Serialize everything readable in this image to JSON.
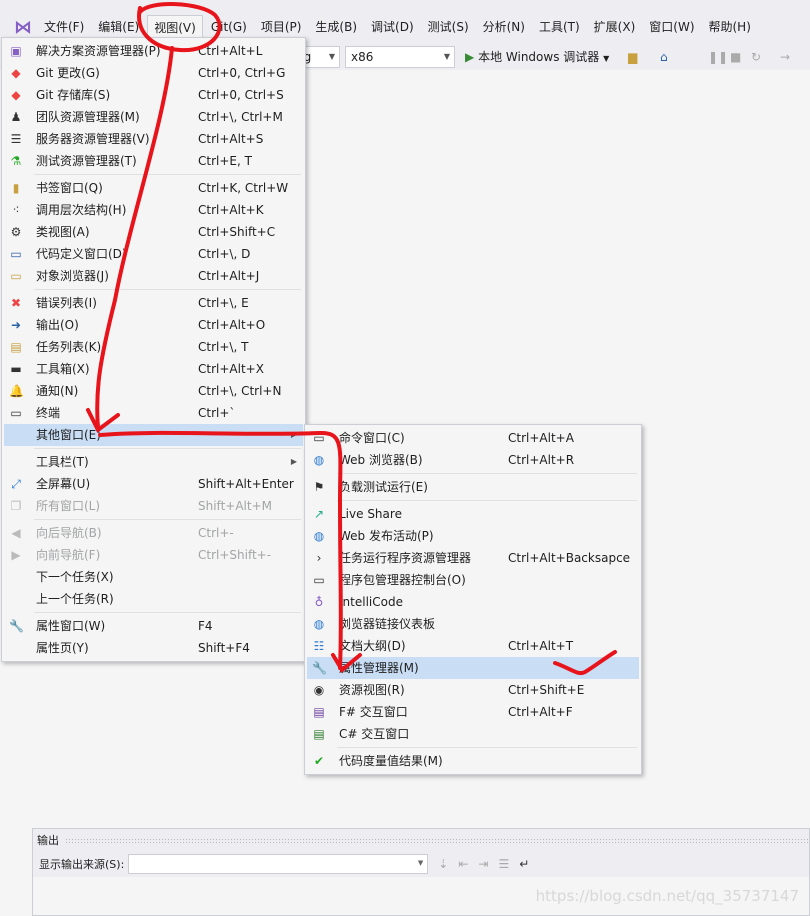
{
  "menubar": [
    "文件(F)",
    "编辑(E)",
    "视图(V)",
    "Git(G)",
    "项目(P)",
    "生成(B)",
    "调试(D)",
    "测试(S)",
    "分析(N)",
    "工具(T)",
    "扩展(X)",
    "窗口(W)",
    "帮助(H)"
  ],
  "toolbar": {
    "config": "ug",
    "platform": "x86",
    "run": "本地 Windows 调试器"
  },
  "view_menu": [
    {
      "icon": "solution-explorer-icon",
      "label": "解决方案资源管理器(P)",
      "shortcut": "Ctrl+Alt+L"
    },
    {
      "icon": "git-changes-icon",
      "label": "Git 更改(G)",
      "shortcut": "Ctrl+0, Ctrl+G"
    },
    {
      "icon": "git-repository-icon",
      "label": "Git 存储库(S)",
      "shortcut": "Ctrl+0, Ctrl+S"
    },
    {
      "icon": "team-explorer-icon",
      "label": "团队资源管理器(M)",
      "shortcut": "Ctrl+\\, Ctrl+M"
    },
    {
      "icon": "server-explorer-icon",
      "label": "服务器资源管理器(V)",
      "shortcut": "Ctrl+Alt+S"
    },
    {
      "icon": "test-explorer-icon",
      "label": "测试资源管理器(T)",
      "shortcut": "Ctrl+E, T",
      "sep": true
    },
    {
      "icon": "bookmark-icon",
      "label": "书签窗口(Q)",
      "shortcut": "Ctrl+K, Ctrl+W"
    },
    {
      "icon": "call-hierarchy-icon",
      "label": "调用层次结构(H)",
      "shortcut": "Ctrl+Alt+K"
    },
    {
      "icon": "class-view-icon",
      "label": "类视图(A)",
      "shortcut": "Ctrl+Shift+C"
    },
    {
      "icon": "code-definition-icon",
      "label": "代码定义窗口(D)",
      "shortcut": "Ctrl+\\, D"
    },
    {
      "icon": "object-browser-icon",
      "label": "对象浏览器(J)",
      "shortcut": "Ctrl+Alt+J",
      "sep": true
    },
    {
      "icon": "error-list-icon",
      "label": "错误列表(I)",
      "shortcut": "Ctrl+\\, E"
    },
    {
      "icon": "output-icon",
      "label": "输出(O)",
      "shortcut": "Ctrl+Alt+O"
    },
    {
      "icon": "task-list-icon",
      "label": "任务列表(K)",
      "shortcut": "Ctrl+\\, T"
    },
    {
      "icon": "toolbox-icon",
      "label": "工具箱(X)",
      "shortcut": "Ctrl+Alt+X"
    },
    {
      "icon": "bell-icon",
      "label": "通知(N)",
      "shortcut": "Ctrl+\\, Ctrl+N"
    },
    {
      "icon": "terminal-icon",
      "label": "终端",
      "shortcut": "Ctrl+`"
    },
    {
      "icon": "",
      "label": "其他窗口(E)",
      "shortcut": "",
      "submenu": true,
      "highlight": true,
      "sep": true
    },
    {
      "icon": "",
      "label": "工具栏(T)",
      "shortcut": "",
      "submenu": true
    },
    {
      "icon": "fullscreen-icon",
      "label": "全屏幕(U)",
      "shortcut": "Shift+Alt+Enter"
    },
    {
      "icon": "all-windows-icon",
      "label": "所有窗口(L)",
      "shortcut": "Shift+Alt+M",
      "disabled": true,
      "sep": true
    },
    {
      "icon": "navigate-back-icon",
      "label": "向后导航(B)",
      "shortcut": "Ctrl+-",
      "disabled": true
    },
    {
      "icon": "navigate-forward-icon",
      "label": "向前导航(F)",
      "shortcut": "Ctrl+Shift+-",
      "disabled": true
    },
    {
      "icon": "",
      "label": "下一个任务(X)",
      "shortcut": ""
    },
    {
      "icon": "",
      "label": "上一个任务(R)",
      "shortcut": "",
      "sep": true
    },
    {
      "icon": "wrench-icon",
      "label": "属性窗口(W)",
      "shortcut": "F4"
    },
    {
      "icon": "",
      "label": "属性页(Y)",
      "shortcut": "Shift+F4"
    }
  ],
  "other_windows_menu": [
    {
      "icon": "command-window-icon",
      "label": "命令窗口(C)",
      "shortcut": "Ctrl+Alt+A"
    },
    {
      "icon": "web-browser-icon",
      "label": "Web 浏览器(B)",
      "shortcut": "Ctrl+Alt+R",
      "sep": true
    },
    {
      "icon": "load-test-icon",
      "label": "负载测试运行(E)",
      "shortcut": "",
      "sep": true
    },
    {
      "icon": "live-share-icon",
      "label": "Live Share",
      "shortcut": ""
    },
    {
      "icon": "web-publish-icon",
      "label": "Web 发布活动(P)",
      "shortcut": ""
    },
    {
      "icon": "chevron-right-icon",
      "label": "任务运行程序资源管理器",
      "shortcut": "Ctrl+Alt+Backsapce"
    },
    {
      "icon": "terminal-icon",
      "label": "程序包管理器控制台(O)",
      "shortcut": ""
    },
    {
      "icon": "lightbulb-icon",
      "label": "IntelliCode",
      "shortcut": ""
    },
    {
      "icon": "browser-link-icon",
      "label": "浏览器链接仪表板",
      "shortcut": ""
    },
    {
      "icon": "document-outline-icon",
      "label": "文档大纲(D)",
      "shortcut": "Ctrl+Alt+T"
    },
    {
      "icon": "wrench-icon",
      "label": "属性管理器(M)",
      "shortcut": "",
      "highlight": true
    },
    {
      "icon": "resource-view-icon",
      "label": "资源视图(R)",
      "shortcut": "Ctrl+Shift+E"
    },
    {
      "icon": "fsharp-interactive-icon",
      "label": "F# 交互窗口",
      "shortcut": "Ctrl+Alt+F"
    },
    {
      "icon": "csharp-interactive-icon",
      "label": "C# 交互窗口",
      "shortcut": "",
      "sep": true
    },
    {
      "icon": "code-metrics-icon",
      "label": "代码度量值结果(M)",
      "shortcut": ""
    }
  ],
  "output": {
    "title": "输出",
    "source_label": "显示输出来源(S):",
    "source_value": ""
  },
  "watermark": "https://blog.csdn.net/qq_35737147",
  "colors": {
    "highlight": "#c9def5",
    "annotation": "#e8141b",
    "vs_purple": "#865fc5"
  }
}
